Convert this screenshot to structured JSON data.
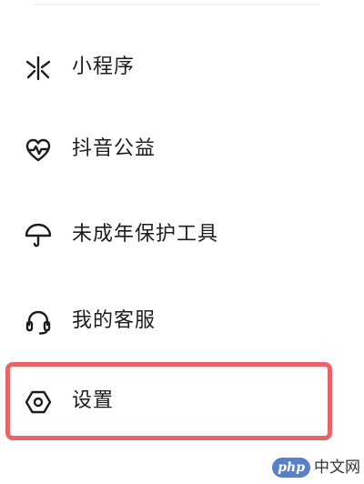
{
  "menu": {
    "items": [
      {
        "label": "小程序",
        "icon": "mini-program-icon"
      },
      {
        "label": "抖音公益",
        "icon": "charity-heart-icon"
      },
      {
        "label": "未成年保护工具",
        "icon": "umbrella-icon"
      },
      {
        "label": "我的客服",
        "icon": "headset-icon"
      },
      {
        "label": "设置",
        "icon": "gear-icon"
      }
    ],
    "highlighted_item": "设置"
  },
  "watermark": {
    "logo": "php",
    "text": "中文网"
  },
  "colors": {
    "text": "#1c1c1e",
    "icon_stroke": "#1c1c1e",
    "highlight_border": "#e8646b",
    "background": "#ffffff",
    "watermark_logo": "#5a7fc9"
  }
}
